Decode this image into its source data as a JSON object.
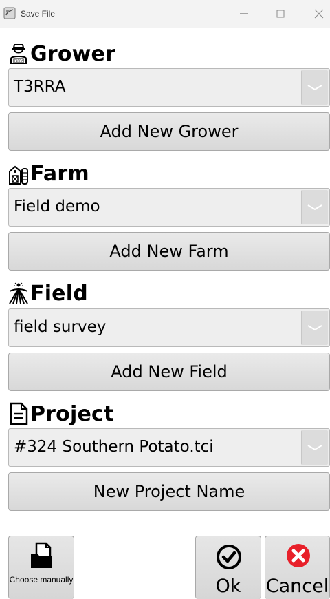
{
  "window": {
    "title": "Save File"
  },
  "sections": {
    "grower": {
      "label": "Grower",
      "selected": "T3RRA",
      "add_button": "Add New Grower"
    },
    "farm": {
      "label": "Farm",
      "selected": "Field demo",
      "add_button": "Add New Farm"
    },
    "field": {
      "label": "Field",
      "selected": "field survey",
      "add_button": "Add New Field"
    },
    "project": {
      "label": "Project",
      "selected": "#324 Southern Potato.tci",
      "add_button": "New Project Name"
    }
  },
  "actions": {
    "choose_manually": "Choose manually",
    "ok": "Ok",
    "cancel": "Cancel"
  },
  "icons": {
    "grower": "farmer-icon",
    "farm": "barn-silo-icon",
    "field": "field-rows-icon",
    "project": "document-icon",
    "choose": "folder-file-icon",
    "ok": "check-circle-icon",
    "cancel": "close-circle-icon"
  },
  "colors": {
    "cancel_red": "#e8202a",
    "button_bg": "#dedede"
  }
}
